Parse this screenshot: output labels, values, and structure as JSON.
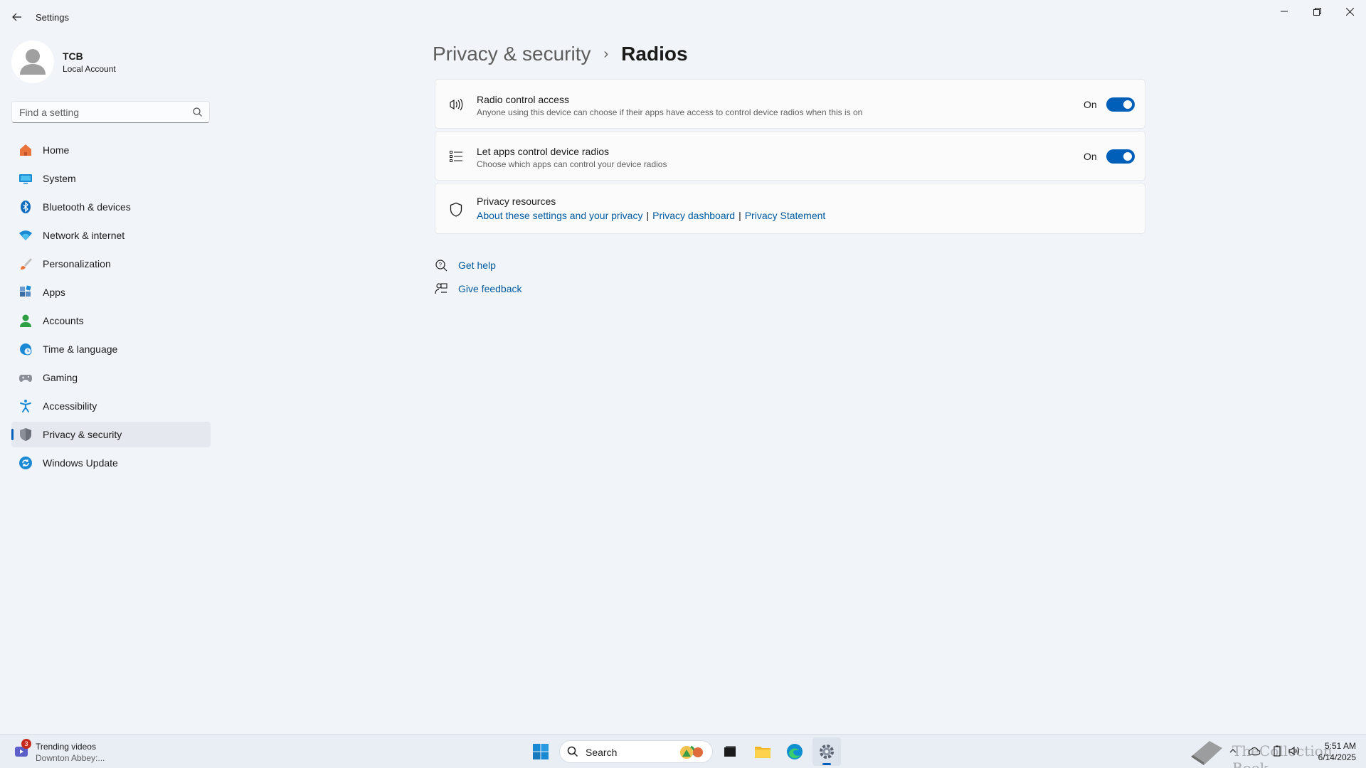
{
  "window": {
    "title": "Settings",
    "back_label": "Back"
  },
  "profile": {
    "name": "TCB",
    "account_type": "Local Account"
  },
  "search": {
    "placeholder": "Find a setting"
  },
  "sidebar": {
    "items": [
      {
        "label": "Home",
        "icon": "home-icon",
        "selected": false
      },
      {
        "label": "System",
        "icon": "system-icon",
        "selected": false
      },
      {
        "label": "Bluetooth & devices",
        "icon": "bluetooth-icon",
        "selected": false
      },
      {
        "label": "Network & internet",
        "icon": "wifi-icon",
        "selected": false
      },
      {
        "label": "Personalization",
        "icon": "brush-icon",
        "selected": false
      },
      {
        "label": "Apps",
        "icon": "apps-icon",
        "selected": false
      },
      {
        "label": "Accounts",
        "icon": "person-icon",
        "selected": false
      },
      {
        "label": "Time & language",
        "icon": "globe-clock-icon",
        "selected": false
      },
      {
        "label": "Gaming",
        "icon": "gamepad-icon",
        "selected": false
      },
      {
        "label": "Accessibility",
        "icon": "accessibility-icon",
        "selected": false
      },
      {
        "label": "Privacy & security",
        "icon": "shield-icon",
        "selected": true
      },
      {
        "label": "Windows Update",
        "icon": "update-icon",
        "selected": false
      }
    ]
  },
  "breadcrumb": {
    "parent": "Privacy & security",
    "separator": "›",
    "current": "Radios"
  },
  "cards": {
    "radio_control": {
      "title": "Radio control access",
      "description": "Anyone using this device can choose if their apps have access to control device radios when this is on",
      "state_label": "On",
      "on": true
    },
    "apps_control": {
      "title": "Let apps control device radios",
      "description": "Choose which apps can control your device radios",
      "state_label": "On",
      "on": true
    },
    "privacy_resources": {
      "title": "Privacy resources",
      "links": [
        "About these settings and your privacy",
        "Privacy dashboard",
        "Privacy Statement"
      ],
      "separator": "|"
    }
  },
  "help": {
    "get_help": "Get help",
    "give_feedback": "Give feedback"
  },
  "taskbar": {
    "widget": {
      "badge": "3",
      "title": "Trending videos",
      "subtitle": "Downton Abbey:..."
    },
    "search_label": "Search",
    "clock_time": "5:51 AM",
    "clock_date": "6/14/2025",
    "watermark": "TheCollection Book"
  },
  "colors": {
    "accent": "#005fb8",
    "link": "#005a9e",
    "background": "#f1f4f9"
  }
}
